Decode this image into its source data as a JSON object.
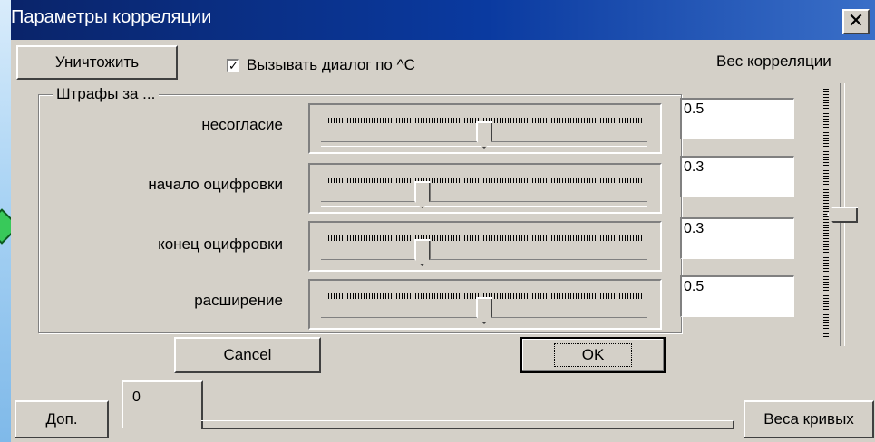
{
  "window": {
    "title": "Параметры корреляции",
    "close_glyph": "✕"
  },
  "toolbar": {
    "destroy_label": "Уничтожить",
    "checkbox_label": "Вызывать диалог по ^C",
    "checkbox_checked": true,
    "checkbox_mark": "✓",
    "weight_label": "Вес корреляции"
  },
  "penalties": {
    "group_title": "Штрафы за ...",
    "rows": [
      {
        "label": "несогласие",
        "value": "0.5",
        "slider_fraction": 0.5
      },
      {
        "label": "начало оцифровки",
        "value": "0.3",
        "slider_fraction": 0.3
      },
      {
        "label": "конец оцифровки",
        "value": "0.3",
        "slider_fraction": 0.3
      },
      {
        "label": "расширение",
        "value": "0.5",
        "slider_fraction": 0.5
      }
    ]
  },
  "correlation_weight": {
    "slider_fraction": 0.5
  },
  "buttons": {
    "cancel_label": "Cancel",
    "ok_label": "OK",
    "extra_label": "Доп.",
    "curve_weights_label": "Веса кривых"
  },
  "tabs": [
    {
      "label": "0"
    }
  ],
  "colors": {
    "dialog_bg": "#d4d0c8",
    "titlebar_start": "#0a246a",
    "titlebar_end": "#3a6fc8",
    "desktop": "#a9d3f4"
  },
  "icons": {
    "close": "close-icon",
    "checkbox": "checkmark-icon",
    "pointer": "green-arrow-pointer-icon"
  }
}
